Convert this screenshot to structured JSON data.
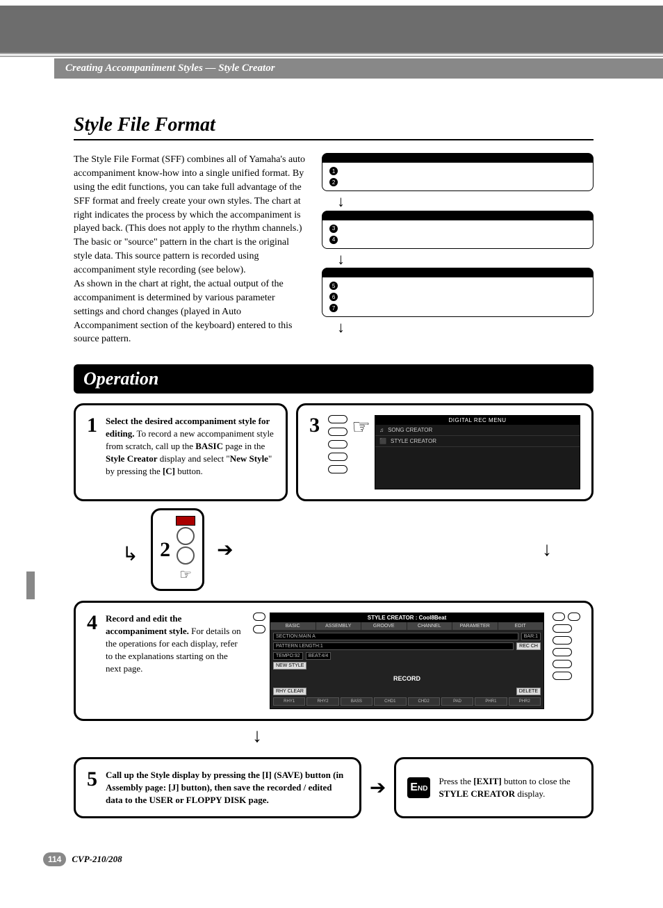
{
  "breadcrumb": "Creating Accompaniment Styles — Style Creator",
  "section": {
    "title": "Style File Format",
    "para1": "The Style File Format (SFF) combines all of Yamaha's auto accompaniment know-how into a single unified format. By using the edit functions, you can take full advantage of the SFF format and freely create your own styles. The chart at right indicates the process by which the accompaniment is played back. (This does not apply to the rhythm channels.) The basic or \"source\" pattern in the chart is the original style data. This source pattern is recorded using accompaniment style recording (see below).",
    "para2": "As shown in the chart at right, the actual output of the accompaniment is determined by various parameter settings and chord changes (played in Auto Accompaniment section of the keyboard) entered to this source pattern."
  },
  "diagram": {
    "bullets": [
      "1",
      "2",
      "3",
      "4",
      "5",
      "6",
      "7"
    ]
  },
  "operation": {
    "title": "Operation",
    "step1": {
      "num": "1",
      "lead": "Select the desired accompaniment style for editing.",
      "rest": " To record a new accompaniment style from scratch, call up the ",
      "b1": "BASIC",
      "mid1": " page in the ",
      "b2": "Style Creator",
      "mid2": " display and select \"",
      "b3": "New Style",
      "mid3": "\" by pressing the ",
      "b4": "[C]",
      "end": " button."
    },
    "step2": {
      "num": "2"
    },
    "step3": {
      "num": "3",
      "screen_title": "DIGITAL REC MENU",
      "menu1": "SONG CREATOR",
      "menu2": "STYLE CREATOR"
    },
    "step4": {
      "num": "4",
      "lead": "Record and edit the accompaniment style.",
      "rest": " For details on the operations for each display, refer to the explanations starting on the next page.",
      "sc_title": "STYLE CREATOR : Cool8Beat",
      "tabs": [
        "BASIC",
        "ASSEMBLY",
        "GROOVE",
        "CHANNEL",
        "PARAMETER",
        "EDIT"
      ],
      "section_label": "SECTION:MAIN A",
      "pattern_label": "PATTERN LENGTH:1",
      "tempo": "TEMPO:92",
      "beat": "BEAT:4/4",
      "bar": "BAR:1",
      "rec": "REC CH",
      "newstyle": "NEW STYLE",
      "record": "RECORD",
      "rhyclear": "RHY CLEAR",
      "delete": "DELETE",
      "channels": [
        "RHY1",
        "RHY2",
        "BASS",
        "CHD1",
        "CHD2",
        "PAD",
        "PHR1",
        "PHR2"
      ]
    },
    "step5": {
      "num": "5",
      "text": "Call up the Style display by pressing the [I] (SAVE) button (in Assembly page: [J] button), then save the recorded / edited data to the USER or FLOPPY DISK page."
    },
    "end": {
      "label": "END",
      "pre": "Press the ",
      "b1": "[EXIT]",
      "mid1": " button to close the ",
      "b2": "STYLE CREATOR",
      "post": " display."
    }
  },
  "footer": {
    "page": "114",
    "model": "CVP-210/208"
  }
}
